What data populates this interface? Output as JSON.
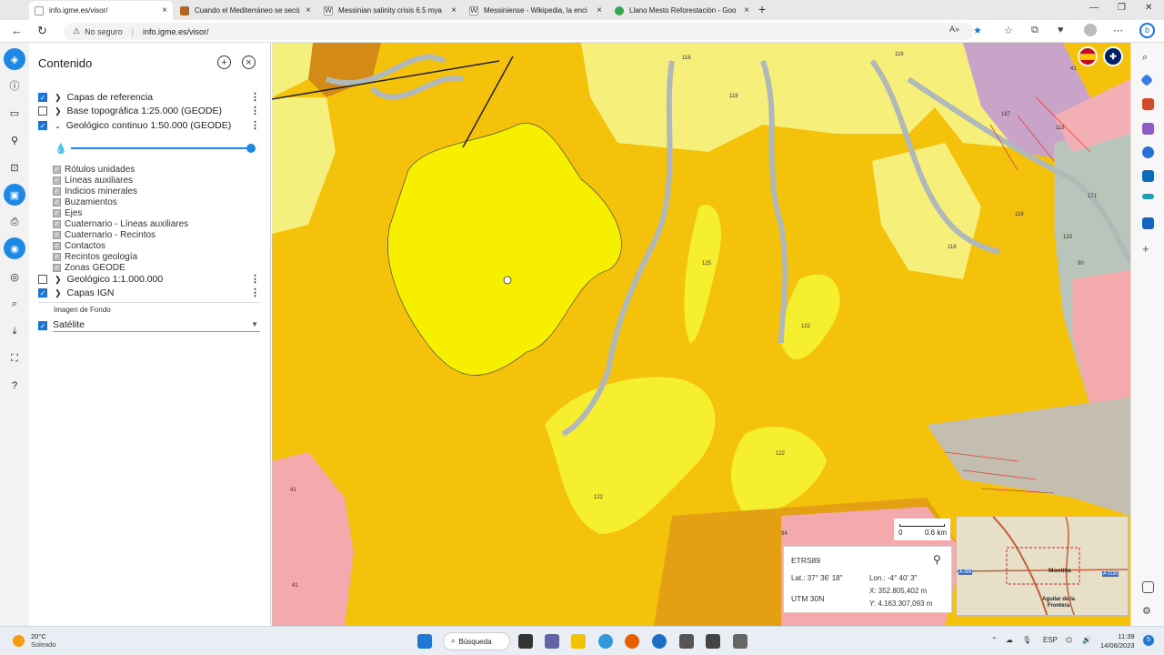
{
  "browser": {
    "tabs": [
      {
        "title": "info.igme.es/visor/",
        "active": true
      },
      {
        "title": "Cuando el Mediterráneo se secó",
        "active": false
      },
      {
        "title": "Messinian salinity crisis 6.5 mya",
        "active": false
      },
      {
        "title": "Messiniense - Wikipedia, la enci",
        "active": false
      },
      {
        "title": "Llano Mesto Reforestación - Goo",
        "active": false
      }
    ],
    "security_label": "No seguro",
    "url": "info.igme.es/visor/"
  },
  "panel": {
    "title": "Contenido",
    "layers": [
      {
        "label": "Capas de referencia",
        "checked": true
      },
      {
        "label": "Base topográfica 1:25.000 (GEODE)",
        "checked": false
      },
      {
        "label": "Geológico continuo 1:50.000 (GEODE)",
        "checked": true
      },
      {
        "label": "Geológico 1:1.000.000",
        "checked": false
      },
      {
        "label": "Capas IGN",
        "checked": true
      }
    ],
    "sublayers": [
      "Rótulos unidades",
      "Líneas auxiliares",
      "Indicios minerales",
      "Buzamientos",
      "Ejes",
      "Cuaternario - Líneas auxiliares",
      "Cuaternario - Recintos",
      "Contactos",
      "Recintos geología",
      "Zonas GEODE"
    ],
    "background_label": "Imagen de Fondo",
    "background_value": "Satélite"
  },
  "map": {
    "unit_labels": [
      "118",
      "118",
      "118",
      "118",
      "118",
      "187",
      "118",
      "41",
      "171",
      "123",
      "125",
      "122",
      "122",
      "122",
      "90",
      "94",
      "41",
      "41"
    ],
    "scale_zero": "0",
    "scale_label": "0.6 km",
    "coords": {
      "datum": "ETRS89",
      "lat": "Lat.: 37° 36' 18\"",
      "lon": "Lon.: -4° 40' 3\"",
      "utm": "UTM 30N",
      "x": "X: 352.805,402 m",
      "y": "Y: 4.163.307,093 m"
    },
    "minimap": {
      "town1": "Montilla",
      "town2": "Aguilar de la Frontera",
      "road1": "A-309",
      "road2": "A-3130"
    }
  },
  "taskbar": {
    "temp": "20°C",
    "weather": "Soleado",
    "search": "Búsqueda",
    "lang": "ESP",
    "time": "11:39",
    "date": "14/06/2023"
  }
}
